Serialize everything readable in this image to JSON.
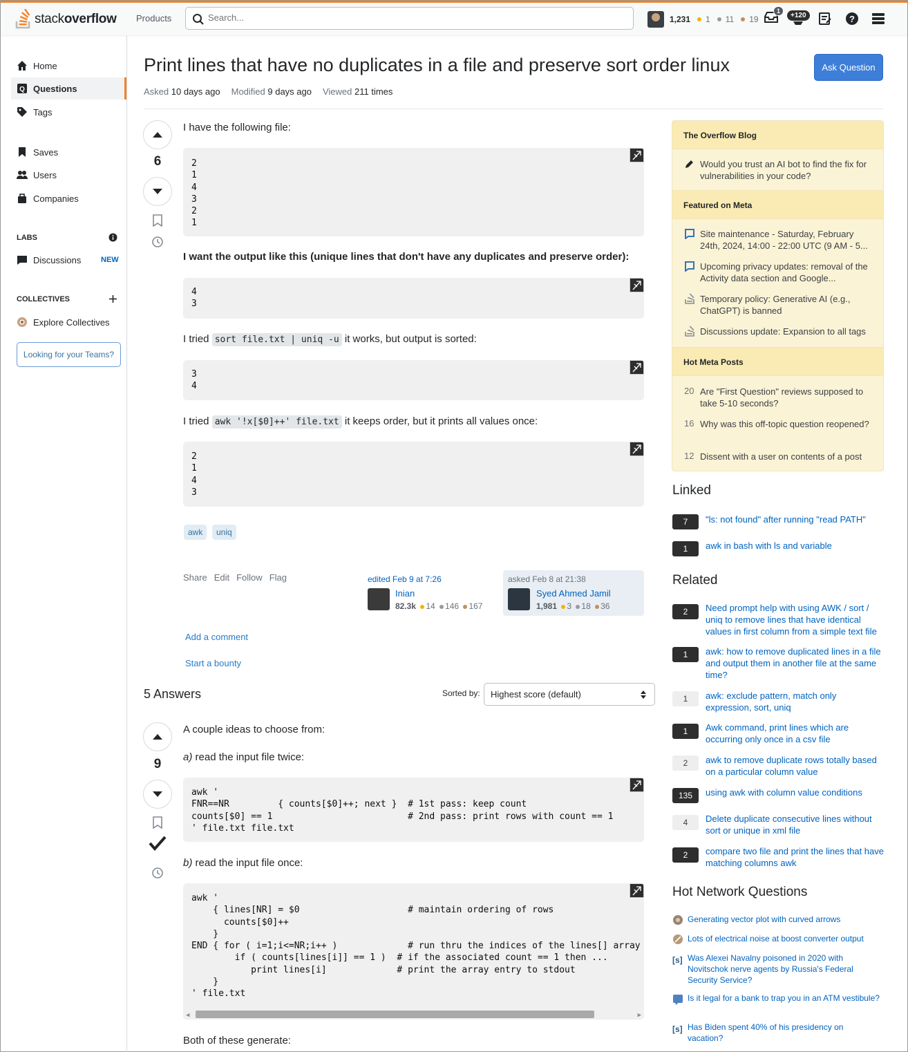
{
  "topbar": {
    "logo_word_light": "stack",
    "logo_word_bold": "overflow",
    "products": "Products",
    "search_placeholder": "Search...",
    "reputation": "1,231",
    "gold": "1",
    "silver": "11",
    "bronze": "19",
    "inbox_count": "1",
    "achievements": "+120",
    "colors": {
      "accent": "#f48225",
      "gold": "#f1b600",
      "silver": "#b4b8bc",
      "bronze": "#d1a684"
    }
  },
  "leftnav": {
    "home": "Home",
    "questions": "Questions",
    "tags": "Tags",
    "saves": "Saves",
    "users": "Users",
    "companies": "Companies",
    "labs": "LABS",
    "discussions": "Discussions",
    "new_badge": "NEW",
    "collectives": "COLLECTIVES",
    "explore_collectives": "Explore Collectives",
    "teams": "Looking for your Teams?"
  },
  "question": {
    "title": "Print lines that have no duplicates in a file and preserve sort order linux",
    "ask_button": "Ask Question",
    "asked_label": "Asked",
    "asked_value": "10 days ago",
    "modified_label": "Modified",
    "modified_value": "9 days ago",
    "viewed_label": "Viewed",
    "viewed_value": "211 times",
    "score": "6",
    "p1": "I have the following file:",
    "code1": "2\n1\n4\n3\n2\n1",
    "p2": "I want the output like this (unique lines that don't have any duplicates and preserve order):",
    "code2": "4\n3",
    "p3_a": "I tried",
    "p3_code": "sort file.txt | uniq -u",
    "p3_b": "it works, but output is sorted:",
    "code3": "3\n4",
    "p4_a": "I tried",
    "p4_code": "awk '!x[$0]++' file.txt",
    "p4_b": "it keeps order, but it prints all values once:",
    "code4": "2\n1\n4\n3",
    "tags": [
      "awk",
      "uniq"
    ],
    "menu": {
      "share": "Share",
      "edit": "Edit",
      "follow": "Follow",
      "flag": "Flag"
    },
    "edited": {
      "label": "edited Feb 9 at 7:26",
      "name": "Inian",
      "rep": "82.3k",
      "gold": "14",
      "silver": "146",
      "bronze": "167"
    },
    "asked": {
      "label": "asked Feb 8 at 21:38",
      "name": "Syed Ahmed Jamil",
      "rep": "1,981",
      "gold": "3",
      "silver": "18",
      "bronze": "36"
    },
    "add_comment": "Add a comment",
    "start_bounty": "Start a bounty"
  },
  "answers": {
    "count_label": "5 Answers",
    "sorted_by": "Sorted by:",
    "sort_value": "Highest score (default)",
    "a1": {
      "score": "9",
      "p1": "A couple ideas to choose from:",
      "p2_em": "a)",
      "p2": "read the input file twice:",
      "code1": "awk '\nFNR==NR         { counts[$0]++; next }  # 1st pass: keep count\ncounts[$0] == 1                         # 2nd pass: print rows with count == 1\n' file.txt file.txt",
      "p3_em": "b)",
      "p3": "read the input file once:",
      "code2": "awk '\n    { lines[NR] = $0                    # maintain ordering of rows\n      counts[$0]++\n    }\nEND { for ( i=1;i<=NR;i++ )             # run thru the indices of the lines[] array and ...\n        if ( counts[lines[i]] == 1 )  # if the associated count == 1 then ...\n           print lines[i]             # print the array entry to stdout\n    }\n' file.txt",
      "p4": "Both of these generate:"
    }
  },
  "sidebar": {
    "blog_title": "The Overflow Blog",
    "blog_items": [
      "Would you trust an AI bot to find the fix for vulnerabilities in your code?"
    ],
    "meta_title": "Featured on Meta",
    "meta_items": [
      "Site maintenance - Saturday, February 24th, 2024, 14:00 - 22:00 UTC (9 AM - 5...",
      "Upcoming privacy updates: removal of the Activity data section and Google...",
      "Temporary policy: Generative AI (e.g., ChatGPT) is banned",
      "Discussions update: Expansion to all tags"
    ],
    "hot_title": "Hot Meta Posts",
    "hot_items": [
      {
        "score": "20",
        "text": "Are \"First Question\" reviews supposed to take 5-10 seconds?"
      },
      {
        "score": "16",
        "text": "Why was this off-topic question reopened?"
      },
      {
        "score": "12",
        "text": "Dissent with a user on contents of a post"
      }
    ],
    "linked_title": "Linked",
    "linked": [
      {
        "score": "7",
        "text": "\"ls: not found\" after running \"read PATH\""
      },
      {
        "score": "1",
        "text": "awk in bash with ls and variable"
      }
    ],
    "related_title": "Related",
    "related": [
      {
        "score": "2",
        "text": "Need prompt help with using AWK / sort / uniq to remove lines that have identical values in first column from a simple text file"
      },
      {
        "score": "1",
        "text": "awk: how to remove duplicated lines in a file and output them in another file at the same time?"
      },
      {
        "score": "1",
        "text": "awk: exclude pattern, match only expression, sort, uniq"
      },
      {
        "score": "1",
        "text": "Awk command, print lines which are occurring only once in a csv file"
      },
      {
        "score": "2",
        "text": "awk to remove duplicate rows totally based on a particular column value"
      },
      {
        "score": "135",
        "text": "using awk with column value conditions"
      },
      {
        "score": "4",
        "text": "Delete duplicate consecutive lines without sort or unique in xml file"
      },
      {
        "score": "2",
        "text": "compare two file and print the lines that have matching columns awk"
      }
    ],
    "hnq_title": "Hot Network Questions",
    "hnq": [
      "Generating vector plot with curved arrows",
      "Lots of electrical noise at boost converter output",
      "Was Alexei Navalny poisoned in 2020 with Novitschok nerve agents by Russia's Federal Security Service?",
      "Is it legal for a bank to trap you in an ATM vestibule?",
      "Has Biden spent 40% of his presidency on vacation?"
    ]
  }
}
